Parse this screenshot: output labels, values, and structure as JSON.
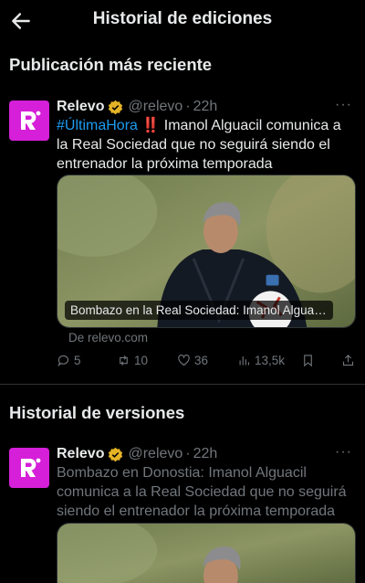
{
  "topbar": {
    "title": "Historial de ediciones",
    "back_icon": "arrow-left-icon"
  },
  "sections": {
    "latest_heading": "Publicación más reciente",
    "history_heading": "Historial de versiones"
  },
  "latest_post": {
    "name": "Relevo",
    "handle": "@relevo",
    "separator": "·",
    "time": "22h",
    "more": "···",
    "hashtag": "#ÚltimaHora",
    "emoji": "‼️",
    "text": " Imanol Alguacil comunica a la Real Sociedad que no seguirá siendo el entrenador la próxima temporada",
    "card_caption": "Bombazo en la Real Sociedad: Imanol Alguacil...",
    "source": "De relevo.com",
    "replies": "5",
    "retweets": "10",
    "likes": "36",
    "views": "13,5k"
  },
  "previous_version": {
    "name": "Relevo",
    "handle": "@relevo",
    "separator": "·",
    "time": "22h",
    "more": "···",
    "text": "Bombazo en Donostia: Imanol Alguacil comunica a la Real Sociedad que no seguirá siendo el entrenador la próxima temporada"
  },
  "colors": {
    "background": "#000000",
    "text": "#e7e9ea",
    "muted": "#71767b",
    "link": "#1d9bf0",
    "brand_avatar": "#d51fd8",
    "verified_badge": "#e5b326"
  }
}
